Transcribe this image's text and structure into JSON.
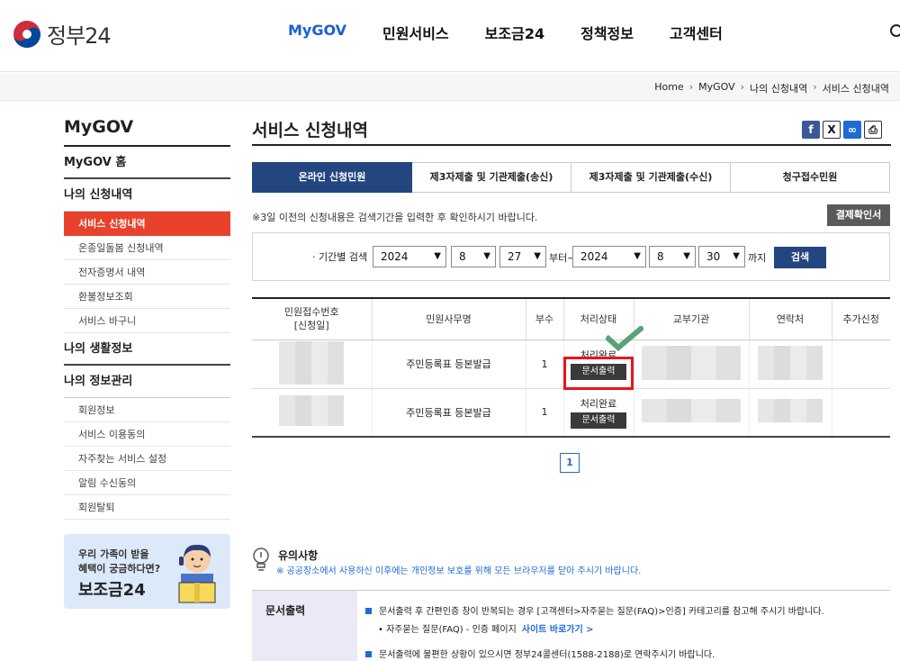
{
  "header": {
    "logo_text": "정부24",
    "nav": [
      "MyGOV",
      "민원서비스",
      "보조금24",
      "정책정보",
      "고객센터"
    ]
  },
  "breadcrumb": [
    "Home",
    "MyGOV",
    "나의 신청내역",
    "서비스 신청내역"
  ],
  "sidebar": {
    "title": "MyGOV",
    "home": "MyGOV 홈",
    "group1": "나의 신청내역",
    "group1_items": [
      "서비스 신청내역",
      "온종일돌봄 신청내역",
      "전자증명서 내역",
      "환불정보조회",
      "서비스 바구니"
    ],
    "group2": "나의 생활정보",
    "group3": "나의 정보관리",
    "group3_items": [
      "회원정보",
      "서비스 이용동의",
      "자주찾는 서비스 설정",
      "알림 수신동의",
      "회원탈퇴"
    ],
    "banner": {
      "line1": "우리 가족이 받을",
      "line2": "혜택이 궁금하다면?",
      "line3": "보조금24"
    }
  },
  "main": {
    "title": "서비스 신청내역",
    "tabs": [
      "온라인 신청민원",
      "제3자제출 및 기관제출(송신)",
      "제3자제출 및 기관제출(수신)",
      "청구접수민원"
    ],
    "notice": "※3일 이전의 신청내용은 검색기간을 입력한 후 확인하시기 바랍니다.",
    "receipt_btn": "결제확인서",
    "search": {
      "label": "· 기간별 검색",
      "from_year": "2024",
      "from_month": "8",
      "from_day": "27",
      "from_text": "부터~",
      "to_year": "2024",
      "to_month": "8",
      "to_day": "30",
      "to_text": "까지",
      "button": "검색"
    },
    "table": {
      "headers": [
        "민원접수번호\n[신청일]",
        "민원사무명",
        "부수",
        "처리상태",
        "교부기관",
        "연락처",
        "추가신청"
      ],
      "rows": [
        {
          "name": "주민등록표 등본발급",
          "copies": "1",
          "status": "처리완료",
          "button": "문서출력"
        },
        {
          "name": "주민등록표 등본발급",
          "copies": "1",
          "status": "처리완료",
          "button": "문서출력"
        }
      ]
    },
    "page": "1",
    "caution": {
      "title": "유의사항",
      "sub": "※ 공공장소에서 사용하신 이후에는 개인정보 보호를 위해 모든 브라우저를 닫아 주시기 바랍니다."
    },
    "guide": {
      "head": "문서출력",
      "line1": "문서출력 후 간편인증 창이 반복되는 경우 [고객센터>자주묻는 질문(FAQ)>인증] 카테고리를 참고해 주시기 바랍니다.",
      "line2": "• 자주묻는 질문(FAQ) - 인증 페이지",
      "link": "사이트 바로가기 >",
      "line3": "문서출력에 불편한 상황이 있으시면 정부24콜센터(1588-2188)로 연락주시기 바랍니다."
    }
  },
  "colors": {
    "accent": "#234680",
    "active_red": "#e8412c",
    "link_blue": "#1f6bd6",
    "highlight": "#e8161c",
    "check_green": "#5aa27a"
  }
}
